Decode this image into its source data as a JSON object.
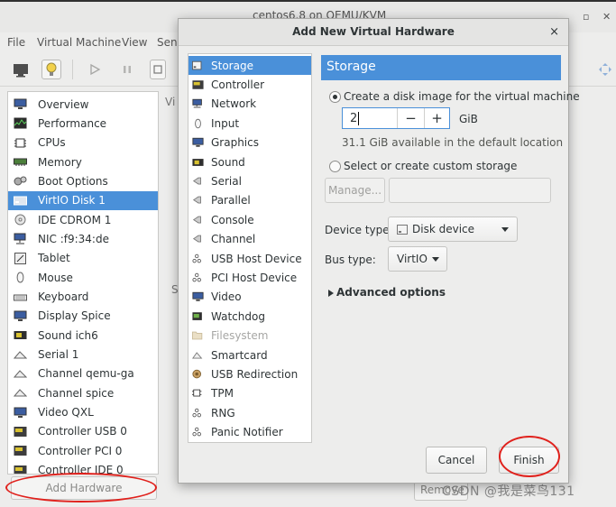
{
  "background_window": {
    "title": "centos6.8 on QEMU/KVM",
    "menu": [
      "File",
      "Virtual Machine",
      "View",
      "Send"
    ],
    "hardware_items": [
      {
        "label": "Overview",
        "icon": "monitor-icon",
        "selected": false
      },
      {
        "label": "Performance",
        "icon": "performance-graph-icon",
        "selected": false
      },
      {
        "label": "CPUs",
        "icon": "cpu-chip-icon",
        "selected": false
      },
      {
        "label": "Memory",
        "icon": "memory-icon",
        "selected": false
      },
      {
        "label": "Boot Options",
        "icon": "boot-gears-icon",
        "selected": false
      },
      {
        "label": "VirtIO Disk 1",
        "icon": "disk-drive-icon",
        "selected": true
      },
      {
        "label": "IDE CDROM 1",
        "icon": "cdrom-icon",
        "selected": false
      },
      {
        "label": "NIC :f9:34:de",
        "icon": "network-card-icon",
        "selected": false
      },
      {
        "label": "Tablet",
        "icon": "tablet-icon",
        "selected": false
      },
      {
        "label": "Mouse",
        "icon": "mouse-icon",
        "selected": false
      },
      {
        "label": "Keyboard",
        "icon": "keyboard-icon",
        "selected": false
      },
      {
        "label": "Display Spice",
        "icon": "display-icon",
        "selected": false
      },
      {
        "label": "Sound ich6",
        "icon": "sound-card-icon",
        "selected": false
      },
      {
        "label": "Serial 1",
        "icon": "serial-port-icon",
        "selected": false
      },
      {
        "label": "Channel qemu-ga",
        "icon": "channel-icon",
        "selected": false
      },
      {
        "label": "Channel spice",
        "icon": "channel-icon",
        "selected": false
      },
      {
        "label": "Video QXL",
        "icon": "video-card-icon",
        "selected": false
      },
      {
        "label": "Controller USB 0",
        "icon": "controller-icon",
        "selected": false
      },
      {
        "label": "Controller PCI 0",
        "icon": "controller-icon",
        "selected": false
      },
      {
        "label": "Controller IDE 0",
        "icon": "controller-icon",
        "selected": false
      }
    ],
    "add_hardware_label": "Add Hardware",
    "remove_label": "Remove",
    "fragment_vi": "Vi",
    "fragment_s": "S"
  },
  "dialog": {
    "title": "Add New Virtual Hardware",
    "close_glyph": "×",
    "device_types": [
      {
        "label": "Storage",
        "icon": "storage-icon",
        "selected": true,
        "disabled": false
      },
      {
        "label": "Controller",
        "icon": "controller-icon",
        "selected": false,
        "disabled": false
      },
      {
        "label": "Network",
        "icon": "network-icon",
        "selected": false,
        "disabled": false
      },
      {
        "label": "Input",
        "icon": "mouse-icon",
        "selected": false,
        "disabled": false
      },
      {
        "label": "Graphics",
        "icon": "display-icon",
        "selected": false,
        "disabled": false
      },
      {
        "label": "Sound",
        "icon": "sound-card-icon",
        "selected": false,
        "disabled": false
      },
      {
        "label": "Serial",
        "icon": "plug-icon",
        "selected": false,
        "disabled": false
      },
      {
        "label": "Parallel",
        "icon": "plug-icon",
        "selected": false,
        "disabled": false
      },
      {
        "label": "Console",
        "icon": "plug-icon",
        "selected": false,
        "disabled": false
      },
      {
        "label": "Channel",
        "icon": "plug-icon",
        "selected": false,
        "disabled": false
      },
      {
        "label": "USB Host Device",
        "icon": "usb-icon",
        "selected": false,
        "disabled": false
      },
      {
        "label": "PCI Host Device",
        "icon": "pci-icon",
        "selected": false,
        "disabled": false
      },
      {
        "label": "Video",
        "icon": "video-card-icon",
        "selected": false,
        "disabled": false
      },
      {
        "label": "Watchdog",
        "icon": "watchdog-icon",
        "selected": false,
        "disabled": false
      },
      {
        "label": "Filesystem",
        "icon": "folder-icon",
        "selected": false,
        "disabled": true
      },
      {
        "label": "Smartcard",
        "icon": "smartcard-icon",
        "selected": false,
        "disabled": false
      },
      {
        "label": "USB Redirection",
        "icon": "usb-redirection-icon",
        "selected": false,
        "disabled": false
      },
      {
        "label": "TPM",
        "icon": "tpm-chip-icon",
        "selected": false,
        "disabled": false
      },
      {
        "label": "RNG",
        "icon": "rng-icon",
        "selected": false,
        "disabled": false
      },
      {
        "label": "Panic Notifier",
        "icon": "panic-notifier-icon",
        "selected": false,
        "disabled": false
      }
    ],
    "storage": {
      "header": "Storage",
      "create_option": "Create a disk image for the virtual machine",
      "create_selected": true,
      "size_value": "2",
      "size_unit": "GiB",
      "available_text": "31.1 GiB available in the default location",
      "custom_option": "Select or create custom storage",
      "manage_label": "Manage...",
      "device_type_label": "Device type:",
      "device_type_value": "Disk device",
      "bus_type_label": "Bus type:",
      "bus_type_value": "VirtIO",
      "advanced_label": "Advanced options"
    },
    "buttons": {
      "cancel": "Cancel",
      "finish": "Finish"
    }
  },
  "watermark": "CSDN @我是菜鸟131",
  "colors": {
    "selection": "#4a90d9",
    "annotation_circle": "#e0211c"
  }
}
